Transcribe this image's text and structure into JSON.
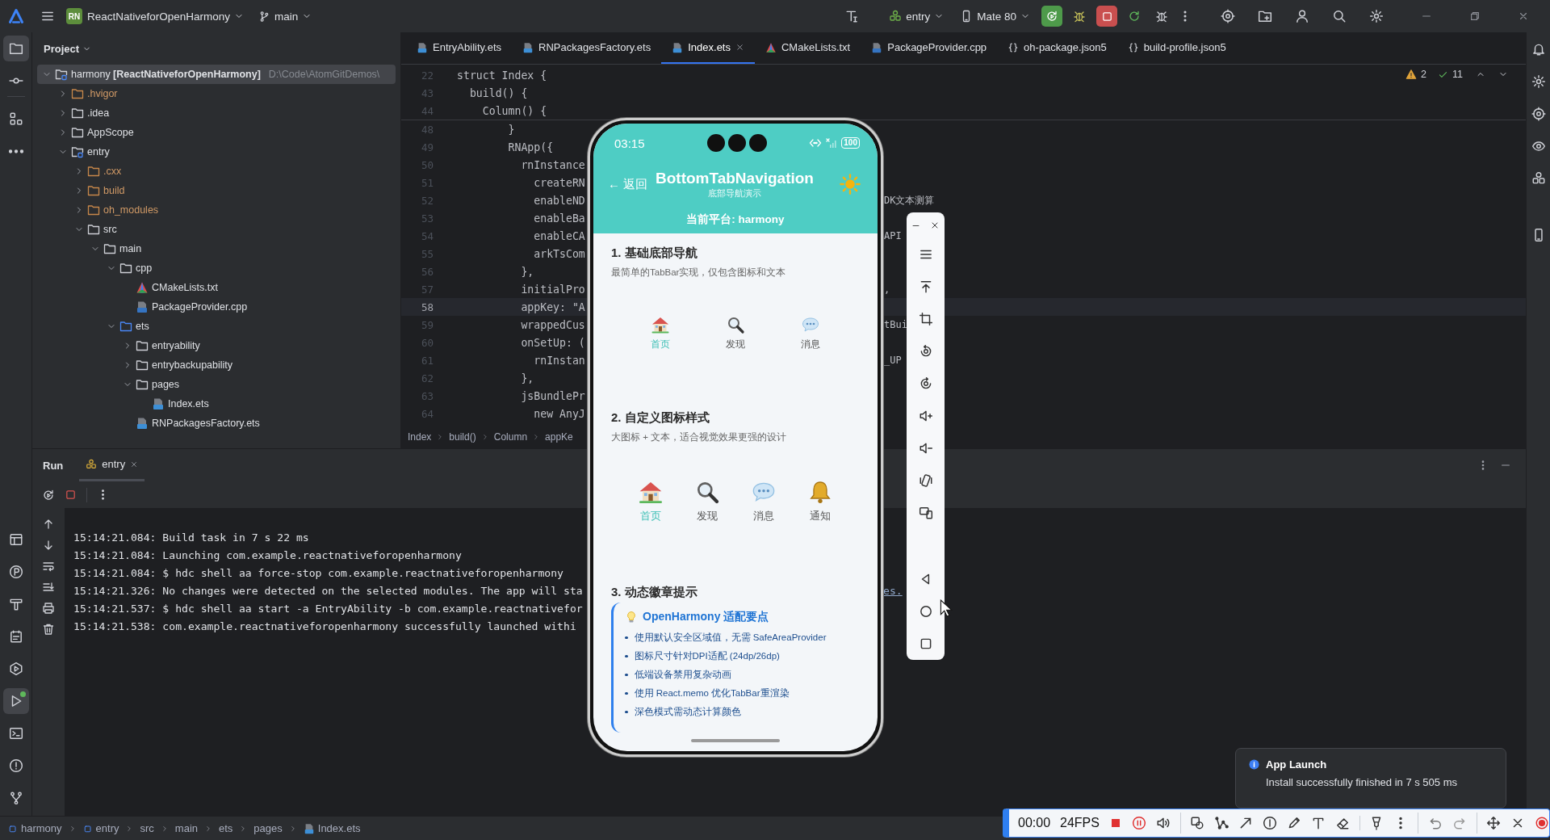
{
  "title_bar": {
    "project_badge": "RN",
    "project": "ReactNativeforOpenHarmony",
    "branch": "main",
    "run_config": "entry",
    "device": "Mate 80"
  },
  "left_toolbar": {
    "top": [
      {
        "selected": true
      },
      {
        "selected": false
      },
      {
        "selected": false
      },
      {
        "selected": false
      }
    ],
    "bottom": [
      {
        "selected": false
      },
      {
        "selected": false
      },
      {
        "selected": false
      },
      {
        "selected": false
      },
      {
        "selected": false
      },
      {
        "selected": true
      },
      {
        "selected": false
      },
      {
        "selected": false
      },
      {
        "selected": false
      }
    ]
  },
  "project_panel": {
    "title": "Project",
    "tree": [
      {
        "label": "harmony **[ReactNativeforOpenHarmony]**",
        "path": "D:\\Code\\AtomGitDemos\\",
        "kind": "module",
        "expanded": true,
        "selected": true,
        "children": [
          {
            "label": ".hvigor",
            "kind": "excluded",
            "expanded": false,
            "selected": false
          },
          {
            "label": ".idea",
            "kind": "folder",
            "expanded": false,
            "selected": false
          },
          {
            "label": "AppScope",
            "kind": "folder",
            "expanded": false,
            "selected": false
          },
          {
            "label": "entry",
            "kind": "module",
            "expanded": true,
            "selected": false,
            "children": [
              {
                "label": ".cxx",
                "kind": "excluded",
                "expanded": false,
                "selected": false
              },
              {
                "label": "build",
                "kind": "excluded",
                "expanded": false,
                "selected": false
              },
              {
                "label": "oh_modules",
                "kind": "excluded",
                "expanded": false,
                "selected": false
              },
              {
                "label": "src",
                "kind": "folder",
                "expanded": true,
                "selected": false,
                "children": [
                  {
                    "label": "main",
                    "kind": "folder",
                    "expanded": true,
                    "selected": false,
                    "children": [
                      {
                        "label": "cpp",
                        "kind": "folder",
                        "expanded": true,
                        "selected": false,
                        "children": [
                          {
                            "label": "CMakeLists.txt",
                            "kind": "cmake",
                            "selected": false
                          },
                          {
                            "label": "PackageProvider.cpp",
                            "kind": "cpp",
                            "selected": false
                          }
                        ]
                      },
                      {
                        "label": "ets",
                        "kind": "sources",
                        "expanded": true,
                        "selected": false,
                        "children": [
                          {
                            "label": "entryability",
                            "kind": "folder",
                            "expanded": false,
                            "selected": false
                          },
                          {
                            "label": "entrybackupability",
                            "kind": "folder",
                            "expanded": false,
                            "selected": false
                          },
                          {
                            "label": "pages",
                            "kind": "folder",
                            "expanded": true,
                            "selected": false,
                            "children": [
                              {
                                "label": "Index.ets",
                                "kind": "ets",
                                "selected": false
                              }
                            ]
                          },
                          {
                            "label": "RNPackagesFactory.ets",
                            "kind": "ets",
                            "selected": false
                          }
                        ]
                      }
                    ]
                  }
                ]
              }
            ]
          }
        ]
      }
    ]
  },
  "editor": {
    "tabs": [
      {
        "label": "EntryAbility.ets",
        "kind": "ets",
        "selected": false
      },
      {
        "label": "RNPackagesFactory.ets",
        "kind": "ets",
        "selected": false
      },
      {
        "label": "Index.ets",
        "kind": "ets",
        "selected": true
      },
      {
        "label": "CMakeLists.txt",
        "kind": "cmake",
        "selected": false
      },
      {
        "label": "PackageProvider.cpp",
        "kind": "cpp",
        "selected": false
      },
      {
        "label": "oh-package.json5",
        "kind": "json",
        "selected": false
      },
      {
        "label": "build-profile.json5",
        "kind": "json",
        "selected": false
      }
    ],
    "inspections": {
      "warnings": "2",
      "passed": "11"
    },
    "sticky_lines": [
      {
        "number": "22",
        "code": "struct Index {"
      },
      {
        "number": "43",
        "code": "  build() {"
      },
      {
        "number": "44",
        "code": "    Column() {"
      }
    ],
    "lines": [
      {
        "number": "48",
        "code": "        }",
        "current": false
      },
      {
        "number": "49",
        "code": "        RNApp({",
        "current": false
      },
      {
        "number": "50",
        "code": "          rnInstance",
        "current": false
      },
      {
        "number": "51",
        "code": "            createRN",
        "current": false
      },
      {
        "number": "52",
        "code": "            enableND",
        "tail": "DK文本测算",
        "current": false
      },
      {
        "number": "53",
        "code": "            enableBa",
        "current": false
      },
      {
        "number": "54",
        "code": "            enableCA",
        "tail": "API",
        "current": false
      },
      {
        "number": "55",
        "code": "            arkTsCom",
        "current": false
      },
      {
        "number": "56",
        "code": "          },",
        "current": false
      },
      {
        "number": "57",
        "code": "          initialPro",
        "tail": ",",
        "current": false
      },
      {
        "number": "58",
        "code": "          appKey: \"A",
        "current": true
      },
      {
        "number": "59",
        "code": "          wrappedCus",
        "tail": "tBui",
        "current": false
      },
      {
        "number": "60",
        "code": "          onSetUp: (",
        "current": false
      },
      {
        "number": "61",
        "code": "            rnInstan",
        "tail": "_UP",
        "current": false
      },
      {
        "number": "62",
        "code": "          },",
        "current": false
      },
      {
        "number": "63",
        "code": "          jsBundlePr",
        "current": false
      },
      {
        "number": "64",
        "code": "            new AnyJ",
        "current": false
      }
    ],
    "breadcrumb": [
      "Index",
      "build()",
      "Column",
      "appKe"
    ]
  },
  "run_panel": {
    "title": "Run",
    "tabs": [
      {
        "label": "entry",
        "selected": true
      }
    ],
    "log": [
      {
        "text": "15:14:21.084: Build task in 7 s 22 ms"
      },
      {
        "text": "15:14:21.084: Launching com.example.reactnativeforopenharmony"
      },
      {
        "text": "15:14:21.084: $ hdc shell aa force-stop com.example.reactnativeforopenharmony"
      },
      {
        "text": "15:14:21.326: No changes were detected on the selected modules. The app will sta",
        "link": "es."
      },
      {
        "text": "15:14:21.537: $ hdc shell aa start -a EntryAbility -b com.example.reactnativefor"
      },
      {
        "text": "15:14:21.538: com.example.reactnativeforopenharmony successfully launched withi"
      }
    ]
  },
  "status_bar": {
    "path": [
      {
        "label": "harmony",
        "kind": "module"
      },
      {
        "label": "entry",
        "kind": "module"
      },
      {
        "label": "src",
        "kind": "folder"
      },
      {
        "label": "main",
        "kind": "folder"
      },
      {
        "label": "ets",
        "kind": "folder"
      },
      {
        "label": "pages",
        "kind": "folder"
      },
      {
        "label": "Index.ets",
        "kind": "ets"
      }
    ]
  },
  "phone": {
    "time": "03:15",
    "battery": "100",
    "back": "← 返回",
    "title": "BottomTabNavigation",
    "subtitle": "底部导航演示",
    "platform": "当前平台: harmony",
    "sections": [
      {
        "kind": "basic",
        "title": "1. 基础底部导航",
        "description": "最简单的TabBar实现，仅包含图标和文本",
        "tabs": [
          {
            "label": "首页",
            "selected": true
          },
          {
            "label": "发现",
            "selected": false
          },
          {
            "label": "消息",
            "selected": false
          }
        ]
      },
      {
        "kind": "large",
        "title": "2. 自定义图标样式",
        "description": "大图标 + 文本，适合视觉效果更强的设计",
        "tabs": [
          {
            "label": "首页",
            "selected": true
          },
          {
            "label": "发现",
            "selected": false
          },
          {
            "label": "消息",
            "selected": false
          },
          {
            "label": "通知",
            "selected": false
          }
        ]
      },
      {
        "kind": "tips",
        "title": "3. 动态徽章提示",
        "tips_title": "OpenHarmony 适配要点",
        "tips": [
          "使用默认安全区域值，无需 SafeAreaProvider",
          "图标尺寸针对DPI适配 (24dp/26dp)",
          "低端设备禁用复杂动画",
          "使用 React.memo 优化TabBar重渲染",
          "深色模式需动态计算颜色"
        ]
      }
    ]
  },
  "notification": {
    "title": "App Launch",
    "message": "Install successfully finished in 7 s 505 ms"
  },
  "recorder": {
    "time": "00:00",
    "fps": "24FPS"
  }
}
